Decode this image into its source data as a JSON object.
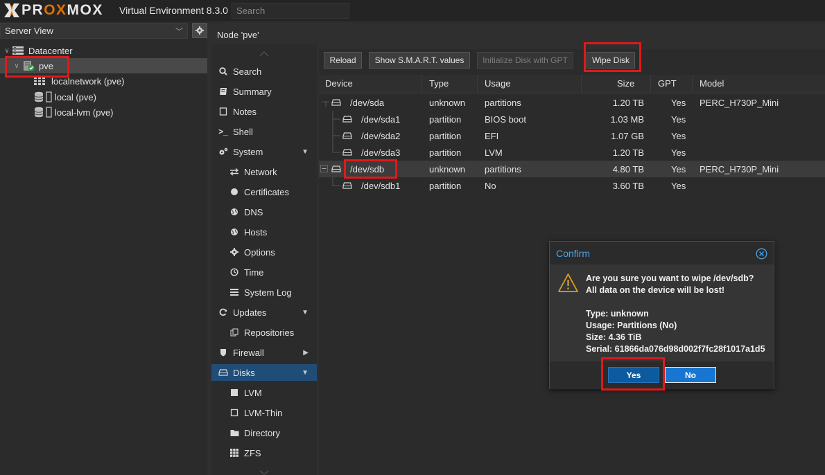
{
  "app": {
    "brand": "PROXMOX",
    "version_label": "Virtual Environment 8.3.0",
    "search_placeholder": "Search"
  },
  "tree": {
    "view_label": "Server View",
    "datacenter": "Datacenter",
    "node": "pve",
    "storages": [
      "localnetwork (pve)",
      "local (pve)",
      "local-lvm (pve)"
    ]
  },
  "node_title": "Node 'pve'",
  "nav": {
    "items": [
      {
        "label": "Search",
        "icon": "search-icon"
      },
      {
        "label": "Summary",
        "icon": "book-icon"
      },
      {
        "label": "Notes",
        "icon": "notes-icon"
      },
      {
        "label": "Shell",
        "icon": "terminal-icon"
      },
      {
        "label": "System",
        "icon": "cogs-icon"
      },
      {
        "label": "Network",
        "icon": "exchange-icon"
      },
      {
        "label": "Certificates",
        "icon": "certificate-icon"
      },
      {
        "label": "DNS",
        "icon": "globe-icon"
      },
      {
        "label": "Hosts",
        "icon": "globe-icon"
      },
      {
        "label": "Options",
        "icon": "gear-icon"
      },
      {
        "label": "Time",
        "icon": "clock-icon"
      },
      {
        "label": "System Log",
        "icon": "list-icon"
      },
      {
        "label": "Updates",
        "icon": "refresh-icon"
      },
      {
        "label": "Repositories",
        "icon": "files-icon"
      },
      {
        "label": "Firewall",
        "icon": "shield-icon"
      },
      {
        "label": "Disks",
        "icon": "hdd-icon"
      },
      {
        "label": "LVM",
        "icon": "square-icon"
      },
      {
        "label": "LVM-Thin",
        "icon": "square-outline-icon"
      },
      {
        "label": "Directory",
        "icon": "folder-icon"
      },
      {
        "label": "ZFS",
        "icon": "th-icon"
      }
    ]
  },
  "toolbar": {
    "reload": "Reload",
    "smart": "Show S.M.A.R.T. values",
    "init_gpt": "Initialize Disk with GPT",
    "wipe": "Wipe Disk"
  },
  "grid": {
    "headers": [
      "Device",
      "Type",
      "Usage",
      "Size",
      "GPT",
      "Model"
    ],
    "rows": [
      {
        "device": "/dev/sda",
        "type": "unknown",
        "usage": "partitions",
        "size": "1.20 TB",
        "gpt": "Yes",
        "model": "PERC_H730P_Mini"
      },
      {
        "device": "/dev/sda1",
        "type": "partition",
        "usage": "BIOS boot",
        "size": "1.03 MB",
        "gpt": "Yes",
        "model": ""
      },
      {
        "device": "/dev/sda2",
        "type": "partition",
        "usage": "EFI",
        "size": "1.07 GB",
        "gpt": "Yes",
        "model": ""
      },
      {
        "device": "/dev/sda3",
        "type": "partition",
        "usage": "LVM",
        "size": "1.20 TB",
        "gpt": "Yes",
        "model": ""
      },
      {
        "device": "/dev/sdb",
        "type": "unknown",
        "usage": "partitions",
        "size": "4.80 TB",
        "gpt": "Yes",
        "model": "PERC_H730P_Mini"
      },
      {
        "device": "/dev/sdb1",
        "type": "partition",
        "usage": "No",
        "size": "3.60 TB",
        "gpt": "Yes",
        "model": ""
      }
    ]
  },
  "dialog": {
    "title": "Confirm",
    "line1": "Are you sure you want to wipe /dev/sdb?",
    "line2": "All data on the device will be lost!",
    "type_line": "Type: unknown",
    "usage_line": "Usage: Partitions (No)",
    "size_line": "Size: 4.36 TiB",
    "serial_line": "Serial: 61866da076d98d002f7fc28f1017a1d5",
    "yes": "Yes",
    "no": "No"
  },
  "colors": {
    "accent_blue": "#1f4d78",
    "brand_orange": "#e57000",
    "highlight_red": "#e0191b",
    "dialog_title": "#4aa3e8",
    "yes_button": "#0d5a9e",
    "no_button": "#1676d2"
  }
}
